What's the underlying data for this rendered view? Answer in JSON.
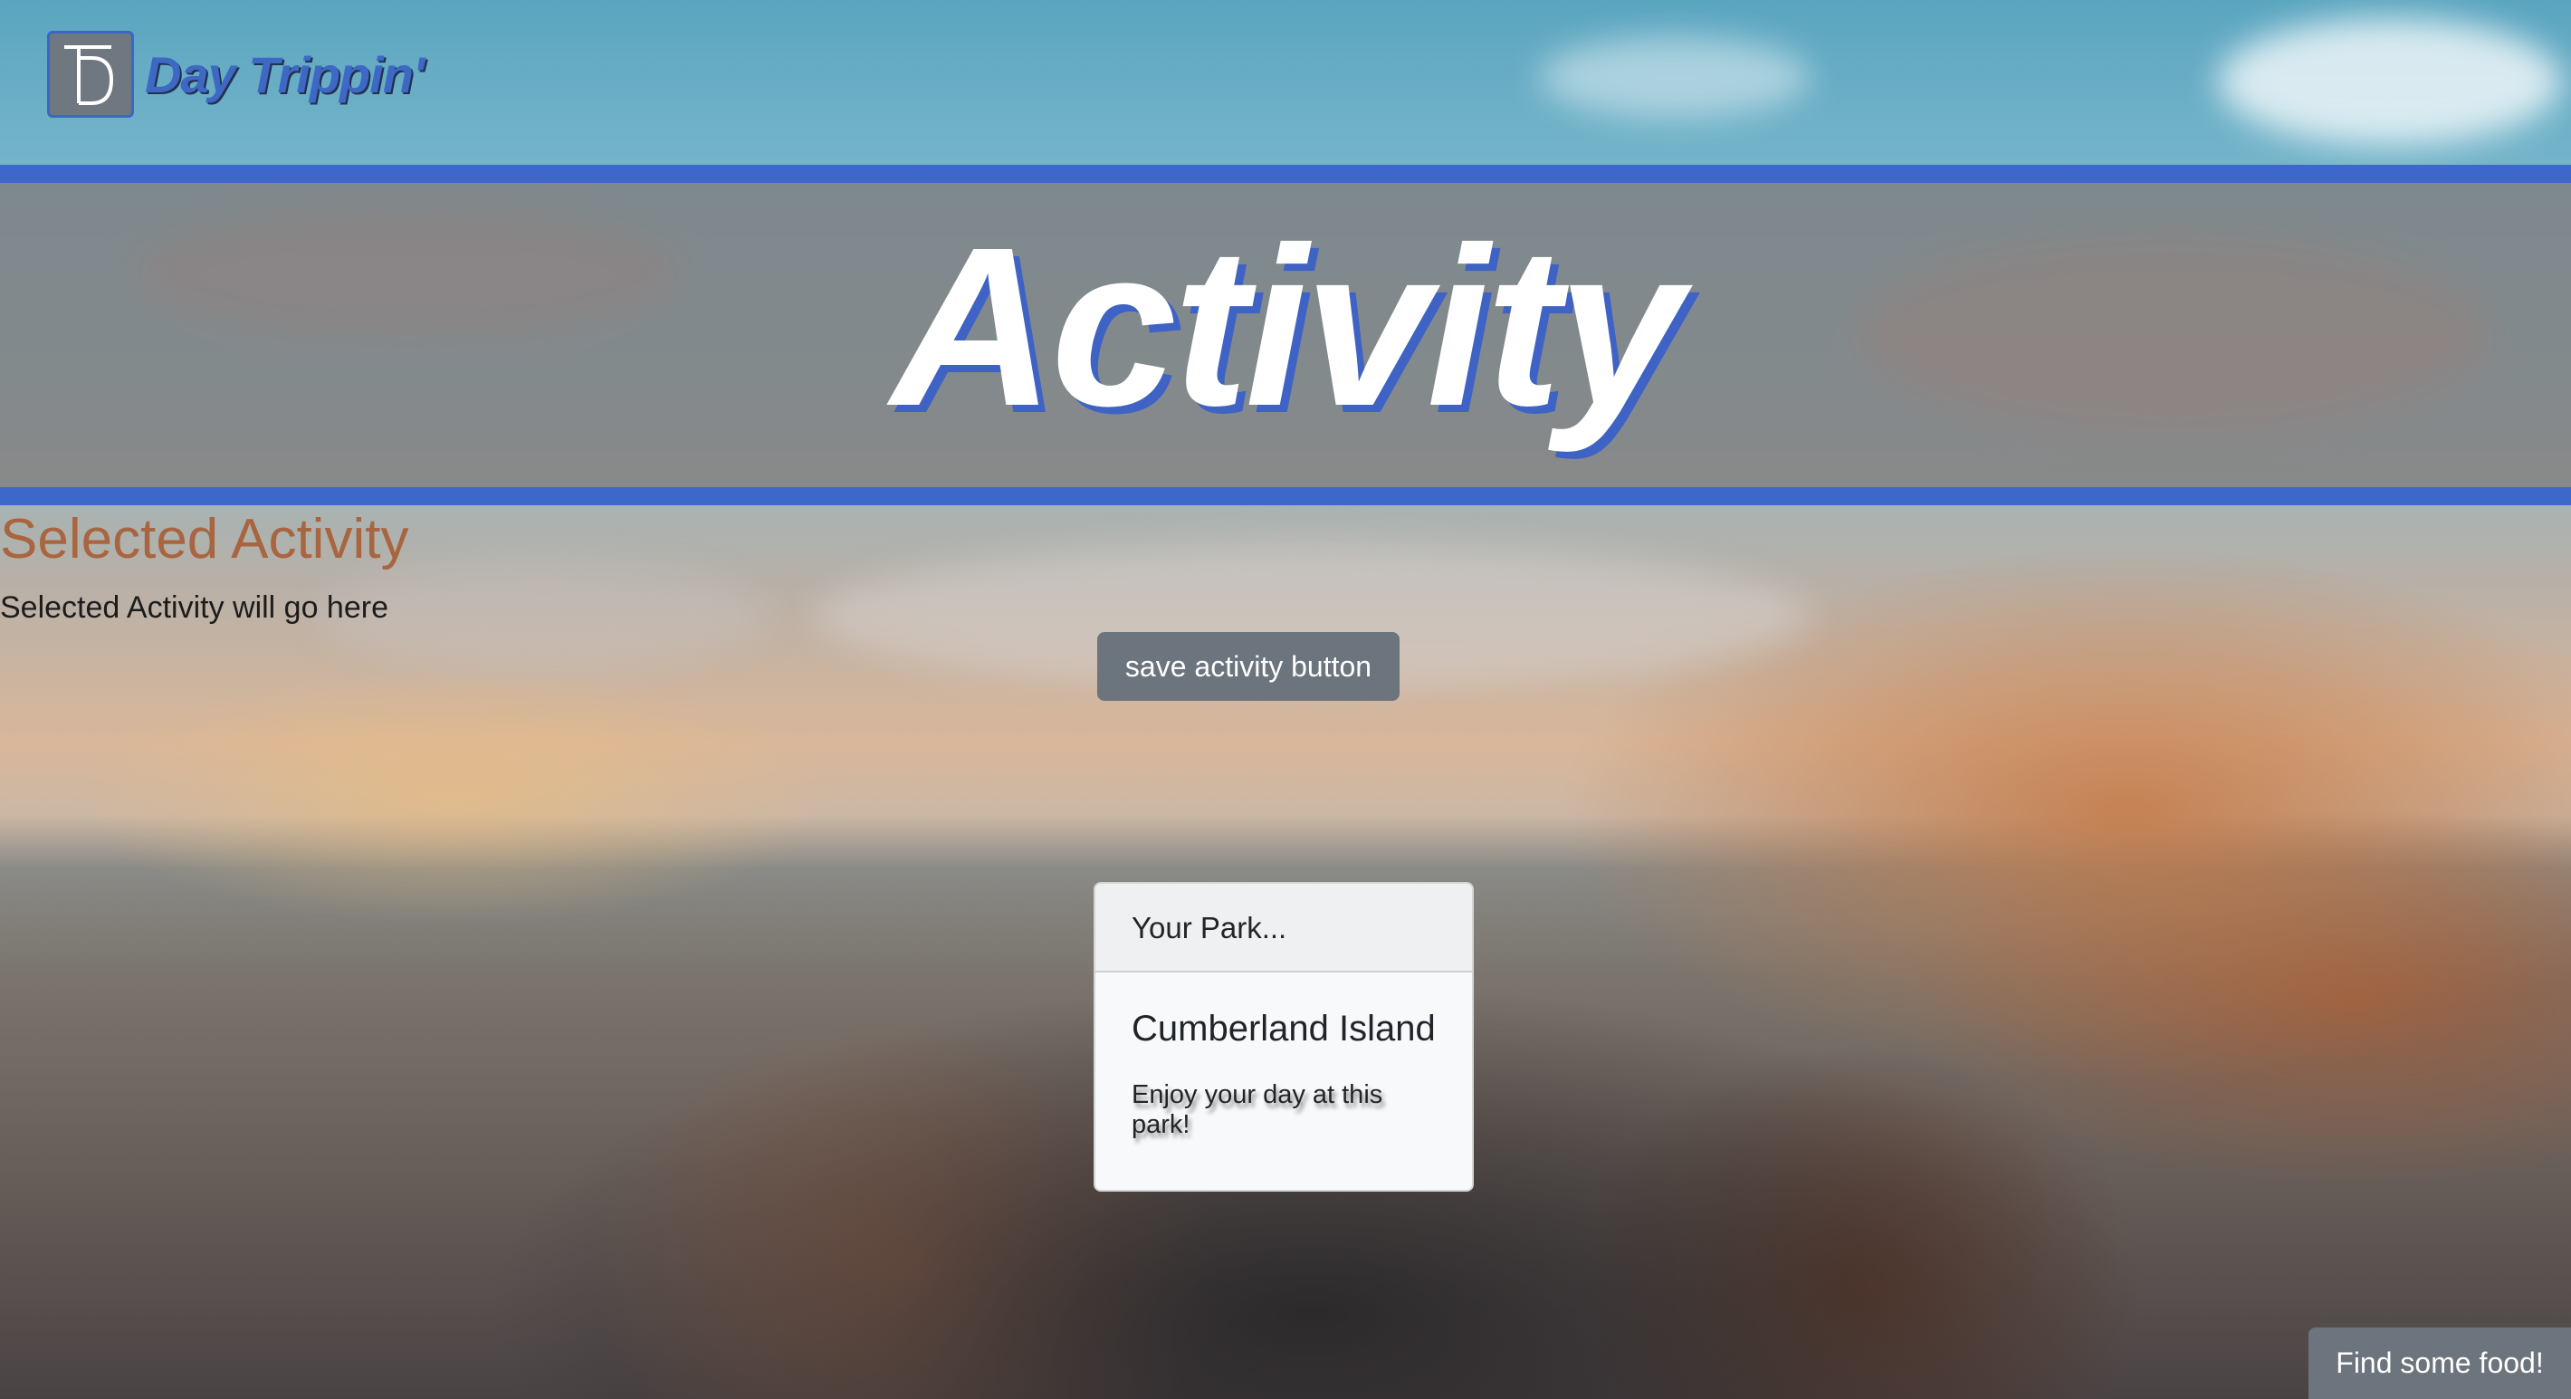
{
  "header": {
    "logo_monogram": "TD",
    "brand_name": "Day Trippin'"
  },
  "banner": {
    "title": "Activity"
  },
  "selected_activity": {
    "heading": "Selected Activity",
    "placeholder_text": "Selected Activity will go here",
    "save_button_label": "save activity button"
  },
  "park_card": {
    "header": "Your Park...",
    "name": "Cumberland Island",
    "message": "Enjoy your day at this park!"
  },
  "food_button": {
    "label": "Find some food!"
  },
  "colors": {
    "accent_blue": "#3e67cc",
    "heading_brown": "#a8653f",
    "button_gray": "#6c757d"
  }
}
